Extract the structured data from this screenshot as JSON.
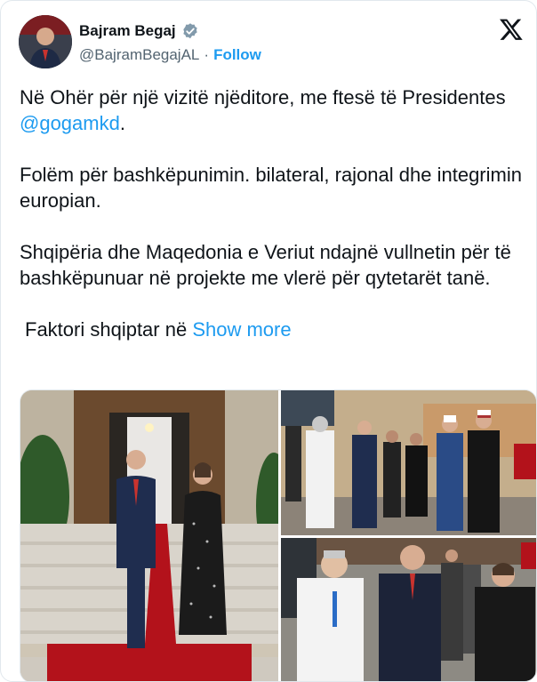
{
  "author": {
    "name": "Bajram Begaj",
    "handle": "@BajramBegajAL",
    "separator": "·",
    "follow_label": "Follow"
  },
  "tweet": {
    "p1_text": "Në Ohër për një vizitë njëditore, me ftesë të Presidentes ",
    "p1_mention": "@gogamkd",
    "p1_end": ".",
    "p2": "Folëm për bashkëpunimin. bilateral, rajonal dhe integrimin europian.",
    "p3": "Shqipëria dhe Maqedonia e Veriut ndajnë vullnetin për të bashkëpunuar në projekte me vlerë për qytetarët tanë.",
    "truncated": "Faktori shqiptar në ",
    "show_more": "Show more"
  },
  "colors": {
    "accent": "#1d9bf0",
    "text": "#0f1419",
    "muted": "#536471",
    "carpet": "#b3121b"
  },
  "icons": {
    "verified": "verified-badge-icon",
    "brand": "x-logo-icon"
  }
}
